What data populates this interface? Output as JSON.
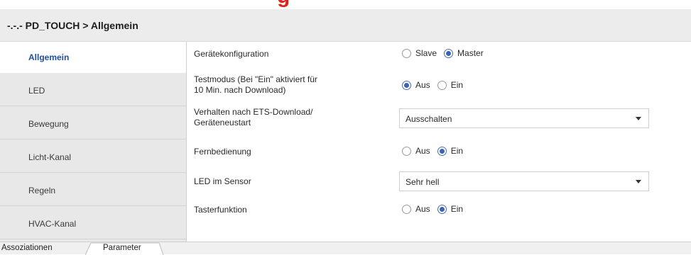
{
  "header": {
    "title": "-.-.- PD_TOUCH > Allgemein"
  },
  "sidebar": {
    "items": [
      {
        "label": "Allgemein",
        "active": true
      },
      {
        "label": "LED",
        "active": false
      },
      {
        "label": "Bewegung",
        "active": false
      },
      {
        "label": "Licht-Kanal",
        "active": false
      },
      {
        "label": "Regeln",
        "active": false
      },
      {
        "label": "HVAC-Kanal",
        "active": false
      }
    ]
  },
  "params": {
    "geraetekonfiguration": {
      "label": "Gerätekonfiguration",
      "options": [
        {
          "label": "Slave",
          "checked": false
        },
        {
          "label": "Master",
          "checked": true
        }
      ]
    },
    "testmodus": {
      "label_line1": "Testmodus (Bei \"Ein\" aktiviert für",
      "label_line2": "10 Min. nach Download)",
      "options": [
        {
          "label": "Aus",
          "checked": true
        },
        {
          "label": "Ein",
          "checked": false
        }
      ]
    },
    "verhalten": {
      "label_line1": "Verhalten nach ETS-Download/",
      "label_line2": "Geräteneustart",
      "value": "Ausschalten"
    },
    "fernbedienung": {
      "label": "Fernbedienung",
      "options": [
        {
          "label": "Aus",
          "checked": false
        },
        {
          "label": "Ein",
          "checked": true
        }
      ]
    },
    "led_im_sensor": {
      "label": "LED im Sensor",
      "value": "Sehr hell"
    },
    "tasterfunktion": {
      "label": "Tasterfunktion",
      "options": [
        {
          "label": "Aus",
          "checked": false
        },
        {
          "label": "Ein",
          "checked": true
        }
      ]
    }
  },
  "tabs": [
    {
      "label": "Assoziationen",
      "active": false
    },
    {
      "label": "Parameter",
      "active": true
    }
  ],
  "colors": {
    "accent": "#3c64b4",
    "active_sidebar_text": "#1f4fa0",
    "header_bg": "#ececec",
    "sidebar_bg": "#e8e8e8",
    "red_mark": "#e1211a"
  }
}
